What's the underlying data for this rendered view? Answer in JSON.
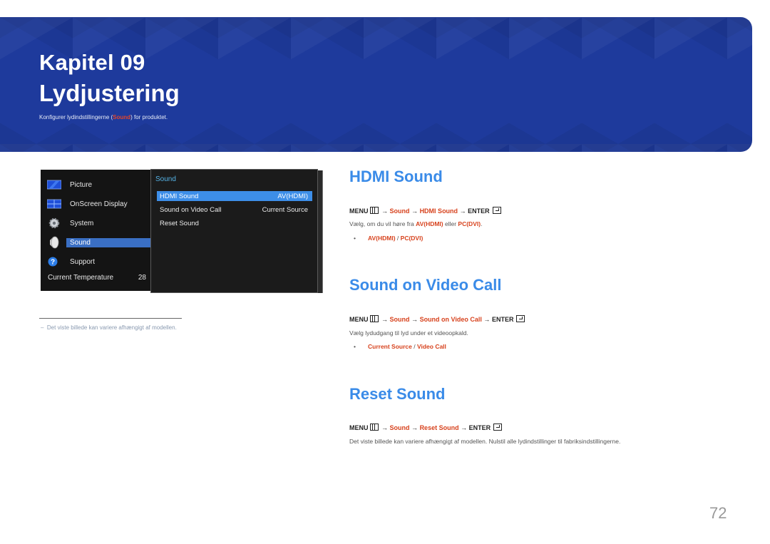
{
  "header": {
    "chapter": "Kapitel 09",
    "title": "Lydjustering",
    "subtitle_pre": "Konfigurer lydindstillingerne (",
    "subtitle_highlight": "Sound",
    "subtitle_post": ") for produktet."
  },
  "osd": {
    "left_menu": [
      {
        "label": "Picture",
        "icon": "picture-icon"
      },
      {
        "label": "OnScreen Display",
        "icon": "onscreen-display-icon"
      },
      {
        "label": "System",
        "icon": "gear-icon"
      },
      {
        "label": "Sound",
        "icon": "speaker-icon",
        "selected": true
      },
      {
        "label": "Support",
        "icon": "help-icon"
      }
    ],
    "temperature_label": "Current Temperature",
    "temperature_value": "28",
    "submenu_title": "Sound",
    "submenu": [
      {
        "label": "HDMI Sound",
        "value": "AV(HDMI)",
        "selected": true
      },
      {
        "label": "Sound on Video Call",
        "value": "Current Source"
      },
      {
        "label": "Reset Sound",
        "value": ""
      }
    ]
  },
  "footnote": "Det viste billede kan variere afhængigt af modellen.",
  "footnote_dash": "–",
  "sections": [
    {
      "title": "HDMI Sound",
      "path": {
        "menu": "MENU",
        "arrow": "→",
        "item1": "Sound",
        "item2": "HDMI Sound",
        "enter": "ENTER"
      },
      "desc_pre": "Vælg, om du vil høre fra ",
      "desc_opt1": "AV(HDMI)",
      "desc_mid": " eller ",
      "desc_opt2": "PC(DVI)",
      "desc_post": ".",
      "options": [
        "AV(HDMI)",
        "PC(DVI)"
      ]
    },
    {
      "title": "Sound on Video Call",
      "path": {
        "menu": "MENU",
        "arrow": "→",
        "item1": "Sound",
        "item2": "Sound on Video Call",
        "enter": "ENTER"
      },
      "desc": "Vælg lydudgang til lyd under et videoopkald.",
      "options": [
        "Current Source",
        "Video Call"
      ]
    },
    {
      "title": "Reset Sound",
      "path": {
        "menu": "MENU",
        "arrow": "→",
        "item1": "Sound",
        "item2": "Reset Sound",
        "enter": "ENTER"
      },
      "desc": "Det viste billede kan variere afhængigt af modellen. Nulstil alle lydindstillinger til fabriksindstillingerne."
    }
  ],
  "bullet_char": "•",
  "option_separator": " / ",
  "page_number": "72",
  "colors": {
    "banner": "#1e3a9c",
    "heading": "#3a8be8",
    "highlight": "#d7421d",
    "osd_selection": "#3d8ee8"
  }
}
